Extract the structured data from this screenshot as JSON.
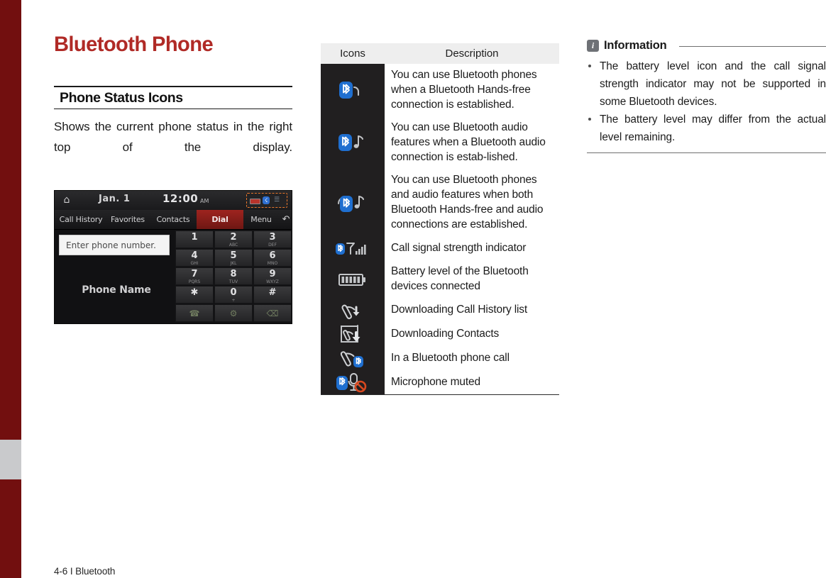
{
  "page": {
    "title": "Bluetooth Phone",
    "title_color": "#b02a26",
    "footer": "4-6 I Bluetooth"
  },
  "section": {
    "heading": "Phone Status Icons",
    "paragraph": "Shows the current phone status in the right top of the display."
  },
  "device_screenshot": {
    "status_bar": {
      "home_icon": "home-icon",
      "date": "Jan.  1",
      "time": "12:00",
      "ampm": "AM",
      "battery_icon": "battery-icon",
      "bluetooth_icon": "bluetooth-icon",
      "signal_icon": "signal-icon"
    },
    "tabs": [
      "Call History",
      "Favorites",
      "Contacts",
      "Dial",
      "Menu",
      "↶"
    ],
    "input_placeholder": "Enter phone number.",
    "phone_name": "Phone Name",
    "keypad": [
      {
        "num": "1",
        "sub": ""
      },
      {
        "num": "2",
        "sub": "ABC"
      },
      {
        "num": "3",
        "sub": "DEF"
      },
      {
        "num": "4",
        "sub": "GHI"
      },
      {
        "num": "5",
        "sub": "JKL"
      },
      {
        "num": "6",
        "sub": "MNO"
      },
      {
        "num": "7",
        "sub": "PQRS"
      },
      {
        "num": "8",
        "sub": "TUV"
      },
      {
        "num": "9",
        "sub": "WXYZ"
      },
      {
        "num": "✱",
        "sub": ""
      },
      {
        "num": "0",
        "sub": "+"
      },
      {
        "num": "#",
        "sub": ""
      }
    ],
    "action_keys": [
      "call-icon",
      "settings-icon",
      "backspace-icon"
    ]
  },
  "table": {
    "headers": {
      "icons": "Icons",
      "description": "Description"
    },
    "rows": [
      {
        "icon": "bluetooth-handsfree-icon",
        "description": "You can use Bluetooth phones when a Bluetooth Hands-free connection is established."
      },
      {
        "icon": "bluetooth-audio-icon",
        "description": "You can use Bluetooth audio features when a Bluetooth audio connection is estab-lished."
      },
      {
        "icon": "bluetooth-handsfree-audio-icon",
        "description": "You can use Bluetooth phones and audio features when both Bluetooth Hands-free and audio connections are established."
      },
      {
        "icon": "call-signal-strength-icon",
        "description": "Call signal strength indicator"
      },
      {
        "icon": "battery-level-icon",
        "description": "Battery level of the Bluetooth devices connected"
      },
      {
        "icon": "downloading-call-history-icon",
        "description": "Downloading Call History list"
      },
      {
        "icon": "downloading-contacts-icon",
        "description": "Downloading Contacts"
      },
      {
        "icon": "in-bluetooth-call-icon",
        "description": "In a Bluetooth phone call"
      },
      {
        "icon": "microphone-muted-icon",
        "description": "Microphone muted"
      }
    ]
  },
  "information": {
    "badge": "i",
    "title": "Information",
    "items": [
      "The battery level icon and the call signal strength indicator may not be supported in some Bluetooth devices.",
      "The battery level may differ from the actual level remaining."
    ]
  }
}
